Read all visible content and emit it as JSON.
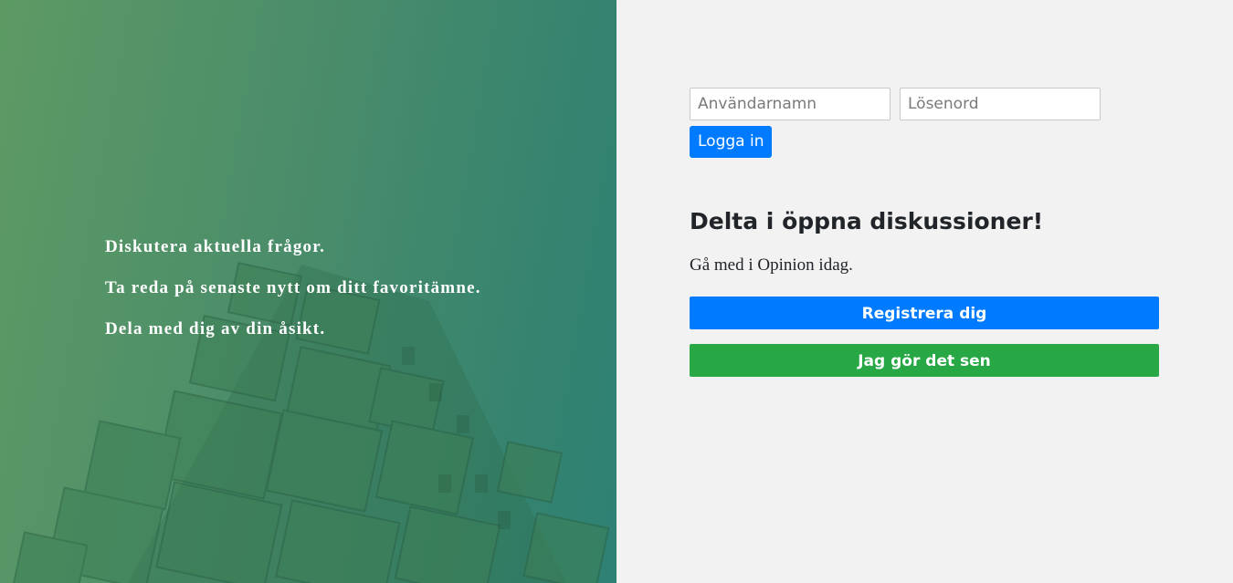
{
  "hero": {
    "taglines": [
      "Diskutera aktuella frågor.",
      "Ta reda på senaste nytt om ditt favoritämne.",
      "Dela med dig av din åsikt."
    ]
  },
  "login": {
    "username_placeholder": "Användarnamn",
    "password_placeholder": "Lösenord",
    "submit_label": "Logga in"
  },
  "signup": {
    "heading": "Delta i öppna diskussioner!",
    "subtext": "Gå med i Opinion idag.",
    "register_label": "Registrera dig",
    "later_label": "Jag gör det sen"
  },
  "colors": {
    "primary": "#007bff",
    "success": "#28a745",
    "panel_background": "#f2f2f2",
    "hero_gradient_start": "#5d9a64",
    "hero_gradient_end": "#2e8174"
  }
}
